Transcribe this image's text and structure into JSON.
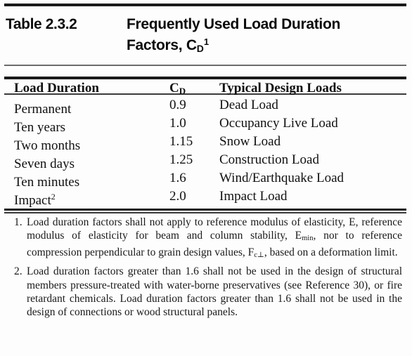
{
  "title": {
    "label": "Table 2.3.2",
    "main_line1": "Frequently Used Load Duration",
    "main_line2_prefix": "Factors, C",
    "main_line2_sub": "D",
    "main_line2_sup": "1"
  },
  "table": {
    "headers": {
      "col1": "Load Duration",
      "col2_base": "C",
      "col2_sub": "D",
      "col3": "Typical Design Loads"
    },
    "rows": [
      {
        "duration": "Permanent",
        "duration_sup": "",
        "cd": "0.9",
        "load": "Dead Load"
      },
      {
        "duration": "Ten years",
        "duration_sup": "",
        "cd": "1.0",
        "load": "Occupancy Live Load"
      },
      {
        "duration": "Two months",
        "duration_sup": "",
        "cd": "1.15",
        "load": "Snow Load"
      },
      {
        "duration": "Seven days",
        "duration_sup": "",
        "cd": "1.25",
        "load": "Construction Load"
      },
      {
        "duration": "Ten minutes",
        "duration_sup": "",
        "cd": "1.6",
        "load": "Wind/Earthquake Load"
      },
      {
        "duration": "Impact",
        "duration_sup": "2",
        "cd": "2.0",
        "load": "Impact Load"
      }
    ]
  },
  "footnotes": [
    {
      "number": "1.",
      "text_part1": "Load duration factors shall not apply to reference modulus of elasticity, E, reference modulus of elasticity for beam and column stability, E",
      "sub1": "min",
      "text_part2": ", nor to reference compression perpendicular to grain design values, F",
      "sub2": "c⊥",
      "text_part3": ", based on a deformation limit."
    },
    {
      "number": "2.",
      "text": "Load duration factors greater than 1.6 shall not be used in the design of structural members pressure-treated with water-borne preservatives (see Reference 30), or fire retardant chemicals. Load duration factors greater than 1.6 shall not be used in the design of connections or wood structural panels."
    }
  ],
  "colors": {
    "page_background": "#fdfdfd",
    "text": "#111111",
    "rule_dark": "#1a1a1a",
    "rule_gray": "#6b6b6b"
  }
}
